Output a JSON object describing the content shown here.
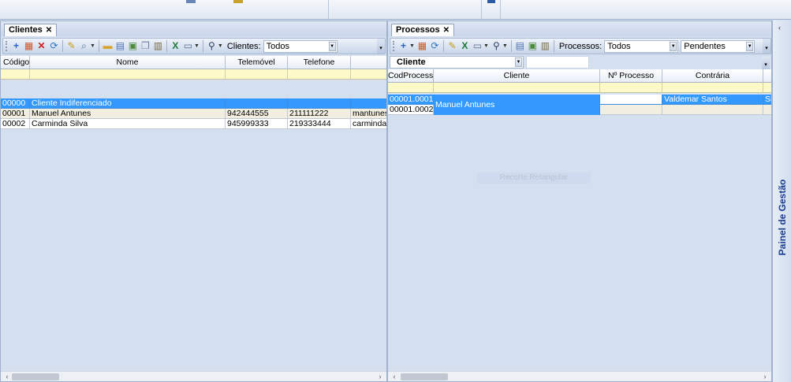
{
  "colors": {
    "selection": "#3399ff",
    "filter_row": "#fdf9c8",
    "panel_bg": "#d4dff0",
    "side_label": "#1b3f8f"
  },
  "ribbon": {
    "icons": [
      "calendar-icon",
      "notes-icon",
      "expand-icon"
    ]
  },
  "left_panel": {
    "tab_label": "Clientes",
    "toolbar": {
      "icons": [
        "add-icon",
        "grid-icon",
        "delete-icon",
        "refresh-icon",
        "new-doc-icon",
        "print-preview-icon",
        "folder-icon",
        "table-icon",
        "export-icon",
        "copy-icon",
        "calculator-icon",
        "excel-icon",
        "print-icon",
        "find-icon"
      ],
      "filter_label": "Clientes:",
      "filter_value": "Todos"
    },
    "columns": [
      "Código",
      "Nome",
      "Telemóvel",
      "Telefone",
      ""
    ],
    "rows": [
      {
        "codigo": "00000",
        "nome": "Cliente Indiferenciado",
        "telemovel": "",
        "telefone": "",
        "email": "",
        "state": "selected"
      },
      {
        "codigo": "00001",
        "nome": "Manuel Antunes",
        "telemovel": "942444555",
        "telefone": "211111222",
        "email": "mantunes@",
        "state": "alt"
      },
      {
        "codigo": "00002",
        "nome": "Carminda Silva",
        "telemovel": "945999333",
        "telefone": "219333444",
        "email": "carmindas@",
        "state": "plain"
      }
    ]
  },
  "right_panel": {
    "tab_label": "Processos",
    "toolbar": {
      "icons": [
        "add-icon",
        "grid-icon",
        "refresh-icon",
        "new-doc-icon",
        "excel-icon",
        "print-icon",
        "find-icon",
        "table-icon",
        "export-icon",
        "calculator-icon"
      ],
      "filter_label": "Processos:",
      "filter_value": "Todos",
      "status_value": "Pendentes"
    },
    "group_by": "Cliente",
    "columns": [
      "CodProcesso",
      "Cliente",
      "Nº Processo",
      "Contrária",
      ""
    ],
    "group_client": "Manuel Antunes",
    "rows": [
      {
        "cod": "00001.0001",
        "numero": "",
        "contraria": "Valdemar Santos",
        "extra": "Si",
        "state": "selected"
      },
      {
        "cod": "00001.0002",
        "numero": "",
        "contraria": "",
        "extra": "",
        "state": "plain"
      }
    ],
    "watermark": "Recorte Retangular"
  },
  "side_panel": {
    "label": "Painel de Gestão"
  }
}
